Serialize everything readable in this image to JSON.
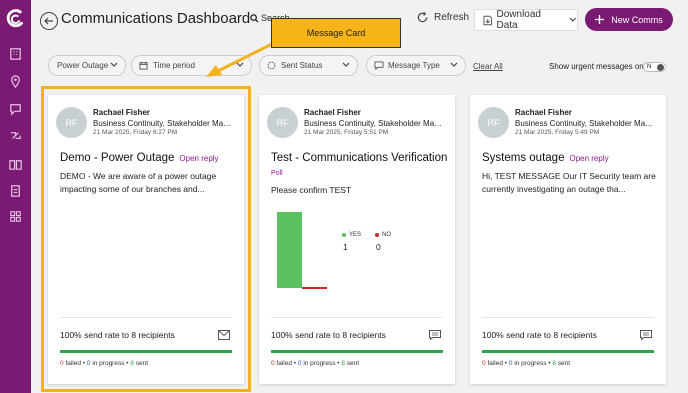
{
  "header": {
    "title": "Communications Dashboard",
    "search_label": "Search",
    "refresh_label": "Refresh",
    "download_label": "Download Data",
    "new_comms_label": "New Comms"
  },
  "filters": {
    "items": [
      {
        "label": "Power Outage"
      },
      {
        "label": "Time period"
      },
      {
        "label": "Sent Status"
      },
      {
        "label": "Message Type"
      }
    ],
    "clear_all": "Clear All",
    "urgent_label": "Show urgent messages only",
    "urgent_toggle": "N"
  },
  "annotation": {
    "callout": "Message Card",
    "accent_color": "#f3b21c"
  },
  "cards": [
    {
      "initials": "RF",
      "sender": "Rachael Fisher",
      "role": "Business Continuity, Stakeholder Management",
      "date": "21 Mar 2025, Friday 6:27 PM",
      "title": "Demo - Power Outage",
      "tag": "Open reply",
      "body": "DEMO - We are aware of a power outage impacting some of our branches and...",
      "send_rate": "100% send rate to 8 recipients",
      "failed": "0",
      "failed_label": "failed",
      "in_progress": "0",
      "in_progress_label": "in progress",
      "sent": "8",
      "sent_label": "sent",
      "icon": "envelope-icon"
    },
    {
      "initials": "RF",
      "sender": "Rachael Fisher",
      "role": "Business Continuity, Stakeholder Management",
      "date": "21 Mar 2025, Friday 5:51 PM",
      "title": "Test - Communications Verification",
      "tag": "Poll",
      "body": "Please confirm TEST",
      "poll": {
        "options": [
          {
            "label": "YES",
            "count": "1",
            "value": 1,
            "color": "#5cbf60"
          },
          {
            "label": "NO",
            "count": "0",
            "value": 0,
            "color": "#c62828"
          }
        ]
      },
      "send_rate": "100% send rate to 8 recipients",
      "failed": "0",
      "failed_label": "failed",
      "in_progress": "0",
      "in_progress_label": "in progress",
      "sent": "8",
      "sent_label": "sent",
      "icon": "chat-icon"
    },
    {
      "initials": "RF",
      "sender": "Rachael Fisher",
      "role": "Business Continuity, Stakeholder Management",
      "date": "21 Mar 2025, Friday 5:49 PM",
      "title": "Systems outage",
      "tag": "Open reply",
      "body": "Hi, TEST MESSAGE Our IT Security team are currently investigating an outage tha...",
      "send_rate": "100% send rate to 8 recipients",
      "failed": "0",
      "failed_label": "failed",
      "in_progress": "0",
      "in_progress_label": "in progress",
      "sent": "8",
      "sent_label": "sent",
      "icon": "chat-icon"
    }
  ],
  "colors": {
    "brand": "#7a1a72",
    "progress": "#2ea44f",
    "tag": "#8a1a88"
  }
}
